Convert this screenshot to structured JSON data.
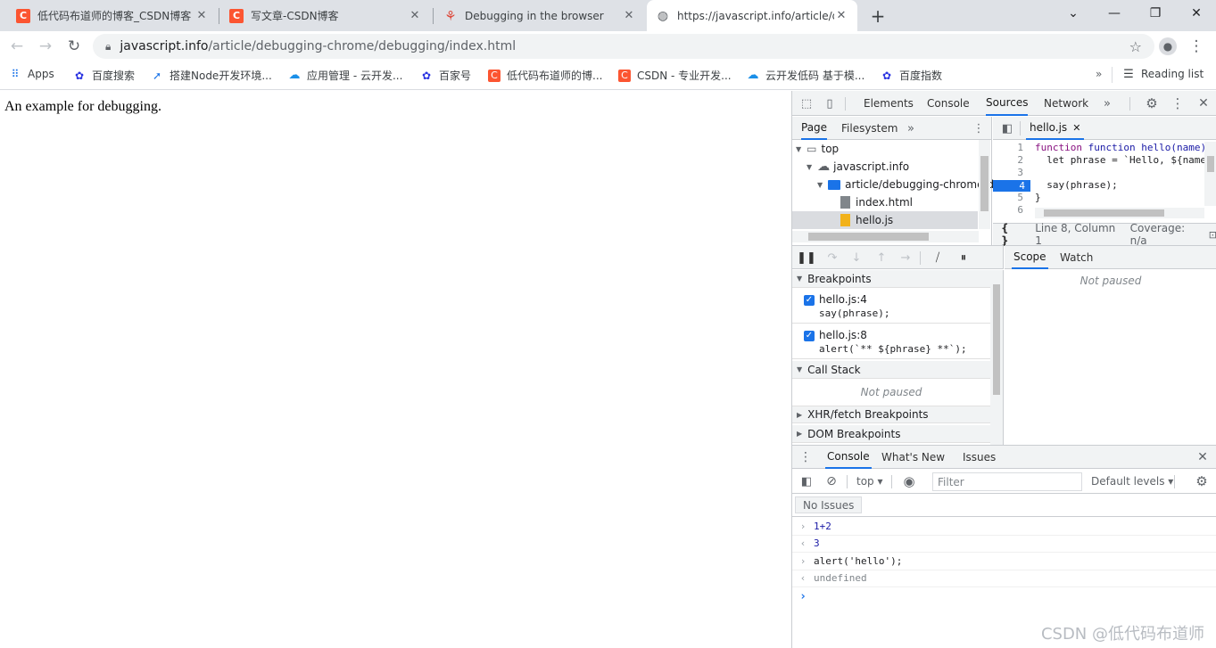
{
  "tabs": [
    {
      "title": "低代码布道师的博客_CSDN博客",
      "favicon": "C",
      "color": "#fc5531"
    },
    {
      "title": "写文章-CSDN博客",
      "favicon": "C",
      "color": "#fc5531"
    },
    {
      "title": "Debugging in the browser",
      "favicon": "javascript-info-icon",
      "color": "#dd4a3c"
    },
    {
      "title": "https://javascript.info/article/d",
      "favicon": "globe-icon",
      "color": "#5f6368"
    }
  ],
  "address": {
    "host": "javascript.info",
    "path": "/article/debugging-chrome/debugging/index.html"
  },
  "bookmarks": {
    "items": [
      {
        "label": "Apps",
        "icon": "apps-grid-icon"
      },
      {
        "label": "百度搜索",
        "icon": "baidu-paw-icon"
      },
      {
        "label": "搭建Node开发环境...",
        "icon": "rocket-icon"
      },
      {
        "label": "应用管理 - 云开发...",
        "icon": "cloud-icon"
      },
      {
        "label": "百家号",
        "icon": "baidu-paw-icon"
      },
      {
        "label": "低代码布道师的博...",
        "icon": "csdn-icon"
      },
      {
        "label": "CSDN - 专业开发...",
        "icon": "csdn-icon"
      },
      {
        "label": "云开发低码 基于模...",
        "icon": "cloud-icon"
      },
      {
        "label": "百度指数",
        "icon": "baidu-paw-icon"
      }
    ],
    "reading_list": "Reading list"
  },
  "page": {
    "text": "An example for debugging."
  },
  "devtools": {
    "main_tabs": [
      "Elements",
      "Console",
      "Sources",
      "Network"
    ],
    "active_main_tab": "Sources",
    "nav_tabs": [
      "Page",
      "Filesystem"
    ],
    "tree": {
      "top": "top",
      "domain": "javascript.info",
      "folder": "article/debugging-chrome/d",
      "file1": "index.html",
      "file2": "hello.js"
    },
    "editor": {
      "file_tab": "hello.js",
      "lines": [
        "function hello(name) {",
        "  let phrase = `Hello, ${name",
        "",
        "  say(phrase);",
        "}",
        ""
      ],
      "breakpoint_line": 4,
      "status": "Line 8, Column 1",
      "coverage": "Coverage: n/a"
    },
    "scope_tabs": [
      "Scope",
      "Watch"
    ],
    "not_paused": "Not paused",
    "breakpoints": {
      "header": "Breakpoints",
      "items": [
        {
          "location": "hello.js:4",
          "code": "say(phrase);"
        },
        {
          "location": "hello.js:8",
          "code": "alert(`** ${phrase} **`);"
        }
      ]
    },
    "sections": {
      "call_stack": "Call Stack",
      "xhr": "XHR/fetch Breakpoints",
      "dom": "DOM Breakpoints"
    },
    "drawer": {
      "tabs": [
        "Console",
        "What's New",
        "Issues"
      ],
      "context": "top",
      "filter_placeholder": "Filter",
      "levels": "Default levels",
      "no_issues": "No Issues",
      "log": [
        {
          "kind": "input",
          "text": "1+2"
        },
        {
          "kind": "output",
          "text": "3"
        },
        {
          "kind": "input",
          "text": "alert('hello');"
        },
        {
          "kind": "output",
          "text": "undefined"
        }
      ]
    }
  },
  "watermark": "CSDN @低代码布道师"
}
